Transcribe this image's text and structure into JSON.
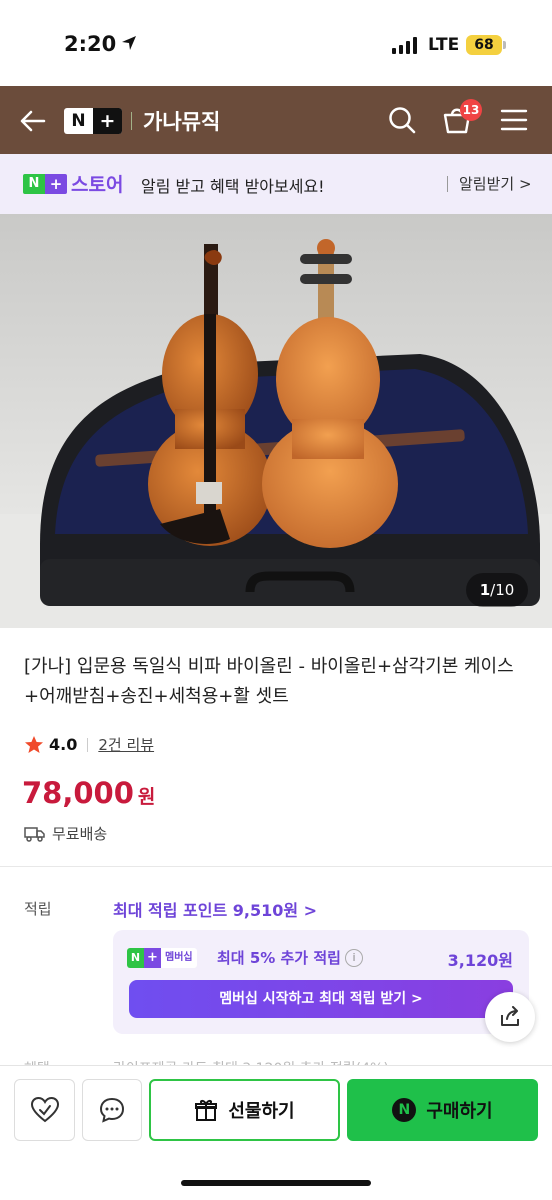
{
  "status": {
    "time": "2:20",
    "network": "LTE",
    "battery": "68"
  },
  "header": {
    "logo_n": "N",
    "logo_plus": "+",
    "store_name": "가나뮤직",
    "cart_count": "13"
  },
  "notify": {
    "logo_n": "N",
    "logo_plus": "+",
    "store_label": "스토어",
    "message": "알림 받고 혜택 받아보세요!",
    "button": "알림받기 >"
  },
  "gallery": {
    "current": "1",
    "total": "/10"
  },
  "product": {
    "title": "[가나] 입문용 독일식 비파 바이올린 - 바이올린+삼각기본 케이스+어깨받침+송진+세척용+활 셋트",
    "rating": "4.0",
    "reviews": "2건 리뷰",
    "price": "78,000",
    "currency": "원",
    "shipping": "무료배송"
  },
  "points": {
    "label": "적립",
    "max_points": "최대 적립 포인트 9,510원 >",
    "membership_badge": "멤버십",
    "membership_n": "N",
    "membership_plus": "+",
    "extra": "최대 5% 추가 적립",
    "info_icon": "i",
    "extra_amount": "3,120원",
    "cta": "멤버십 시작하고 최대 적립 받기 >",
    "cutoff_label": "혜택",
    "cutoff_text": "라이프제공 카드 최대 3,120원 추가 적립(4%)"
  },
  "bottom": {
    "gift": "선물하기",
    "buy": "구매하기",
    "buy_icon": "N"
  },
  "colors": {
    "header": "#6b4c3b",
    "accent_green": "#1fc04a",
    "accent_purple": "#6e44d8",
    "price_red": "#c81a3c"
  }
}
